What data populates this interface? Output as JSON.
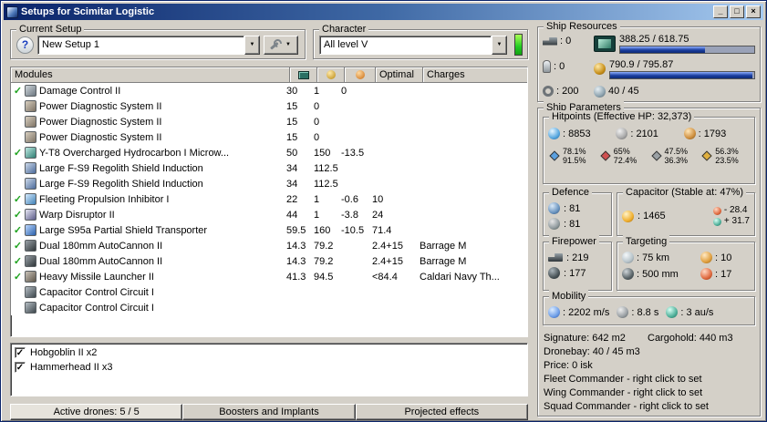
{
  "window": {
    "title": "Setups for Scimitar Logistic"
  },
  "icons": {
    "help": "?",
    "arrow": "▼",
    "check": "✓",
    "minimize": "_",
    "maximize": "□",
    "close": "×"
  },
  "current_setup": {
    "label": "Current Setup",
    "value": "New Setup 1"
  },
  "character": {
    "label": "Character",
    "value": "All level V"
  },
  "modules": {
    "headers": {
      "name": "Modules",
      "optimal": "Optimal",
      "charges": "Charges"
    },
    "rows": [
      {
        "active": true,
        "icon": "damage-control",
        "name": "Damage Control II",
        "cpu": "30",
        "pg": "1",
        "cap": "0",
        "optimal": "",
        "charges": ""
      },
      {
        "active": false,
        "icon": "power-diagnostic",
        "name": "Power Diagnostic System II",
        "cpu": "15",
        "pg": "0",
        "cap": "",
        "optimal": "",
        "charges": ""
      },
      {
        "active": false,
        "icon": "power-diagnostic",
        "name": "Power Diagnostic System II",
        "cpu": "15",
        "pg": "0",
        "cap": "",
        "optimal": "",
        "charges": ""
      },
      {
        "active": false,
        "icon": "power-diagnostic",
        "name": "Power Diagnostic System II",
        "cpu": "15",
        "pg": "0",
        "cap": "",
        "optimal": "",
        "charges": ""
      },
      {
        "active": true,
        "icon": "afterburner",
        "name": "Y-T8 Overcharged Hydrocarbon I Microw...",
        "cpu": "50",
        "pg": "150",
        "cap": "-13.5",
        "optimal": "",
        "charges": ""
      },
      {
        "active": false,
        "icon": "shield-rig",
        "name": "Large F-S9 Regolith Shield Induction",
        "cpu": "34",
        "pg": "112.5",
        "cap": "",
        "optimal": "",
        "charges": ""
      },
      {
        "active": false,
        "icon": "shield-rig",
        "name": "Large F-S9 Regolith Shield Induction",
        "cpu": "34",
        "pg": "112.5",
        "cap": "",
        "optimal": "",
        "charges": ""
      },
      {
        "active": true,
        "icon": "web",
        "name": "Fleeting Propulsion Inhibitor I",
        "cpu": "22",
        "pg": "1",
        "cap": "-0.6",
        "optimal": "10",
        "charges": ""
      },
      {
        "active": true,
        "icon": "disruptor",
        "name": "Warp Disruptor II",
        "cpu": "44",
        "pg": "1",
        "cap": "-3.8",
        "optimal": "24",
        "charges": ""
      },
      {
        "active": true,
        "icon": "shield-transporter",
        "name": "Large S95a Partial Shield Transporter",
        "cpu": "59.5",
        "pg": "160",
        "cap": "-10.5",
        "optimal": "71.4",
        "charges": ""
      },
      {
        "active": true,
        "icon": "autocannon",
        "name": "Dual 180mm AutoCannon II",
        "cpu": "14.3",
        "pg": "79.2",
        "cap": "",
        "optimal": "2.4+15",
        "charges": "Barrage M"
      },
      {
        "active": true,
        "icon": "autocannon",
        "name": "Dual 180mm AutoCannon II",
        "cpu": "14.3",
        "pg": "79.2",
        "cap": "",
        "optimal": "2.4+15",
        "charges": "Barrage M"
      },
      {
        "active": true,
        "icon": "missile-launcher",
        "name": "Heavy Missile Launcher II",
        "cpu": "41.3",
        "pg": "94.5",
        "cap": "",
        "optimal": "<84.4",
        "charges": "Caldari Navy Th..."
      },
      {
        "active": false,
        "icon": "rig",
        "name": "Capacitor Control Circuit I",
        "cpu": "",
        "pg": "",
        "cap": "",
        "optimal": "",
        "charges": ""
      },
      {
        "active": false,
        "icon": "rig",
        "name": "Capacitor Control Circuit I",
        "cpu": "",
        "pg": "",
        "cap": "",
        "optimal": "",
        "charges": ""
      }
    ]
  },
  "drones": [
    {
      "checked": true,
      "name": "Hobgoblin II x2"
    },
    {
      "checked": true,
      "name": "Hammerhead II x3"
    }
  ],
  "bottom_tabs": [
    {
      "label": "Active drones: 5 / 5",
      "active": true
    },
    {
      "label": "Boosters and Implants",
      "active": false
    },
    {
      "label": "Projected effects",
      "active": false
    }
  ],
  "ship_resources": {
    "label": "Ship Resources",
    "turrets": ": 0",
    "launchers": ": 0",
    "calibration": ": 200",
    "cpu_text": "388.25 / 618.75",
    "cpu_pct": 63,
    "pg_text": "790.9 / 795.87",
    "pg_pct": 99,
    "drone_text": "40 / 45"
  },
  "ship_parameters": {
    "label": "Ship Parameters",
    "hitpoints": {
      "label": "Hitpoints (Effective HP: 32,373)",
      "shield": ": 8853",
      "armor": ": 2101",
      "hull": ": 1793",
      "resists": [
        {
          "type": "em",
          "top": "78.1%",
          "bottom": "91.5%"
        },
        {
          "type": "thermal",
          "top": "65%",
          "bottom": "72.4%"
        },
        {
          "type": "kinetic",
          "top": "47.5%",
          "bottom": "36.3%"
        },
        {
          "type": "explosive",
          "top": "56.3%",
          "bottom": "23.5%"
        }
      ]
    },
    "defence": {
      "label": "Defence",
      "row1": ": 81",
      "row2": ": 81"
    },
    "capacitor": {
      "label": "Capacitor (Stable at: 47%)",
      "amount": ": 1465",
      "drain": "- 28.4",
      "recharge": "+ 31.7"
    },
    "firepower": {
      "label": "Firepower",
      "volley": ": 219",
      "dps": ": 177"
    },
    "targeting": {
      "label": "Targeting",
      "range": ": 75 km",
      "max_targets": ": 10",
      "scan_res": ": 500 mm",
      "sensor": ": 17"
    },
    "mobility": {
      "label": "Mobility",
      "speed": ": 2202 m/s",
      "align": ": 8.8 s",
      "warp": ": 3 au/s"
    },
    "info": {
      "signature": "Signature: 642 m2",
      "cargohold": "Cargohold: 440 m3",
      "dronebay": "Dronebay: 40 / 45 m3",
      "price": "Price: 0 isk",
      "fleet": "Fleet Commander - right click to set",
      "wing": "Wing Commander - right click to set",
      "squad": "Squad Commander - right click to set"
    }
  }
}
